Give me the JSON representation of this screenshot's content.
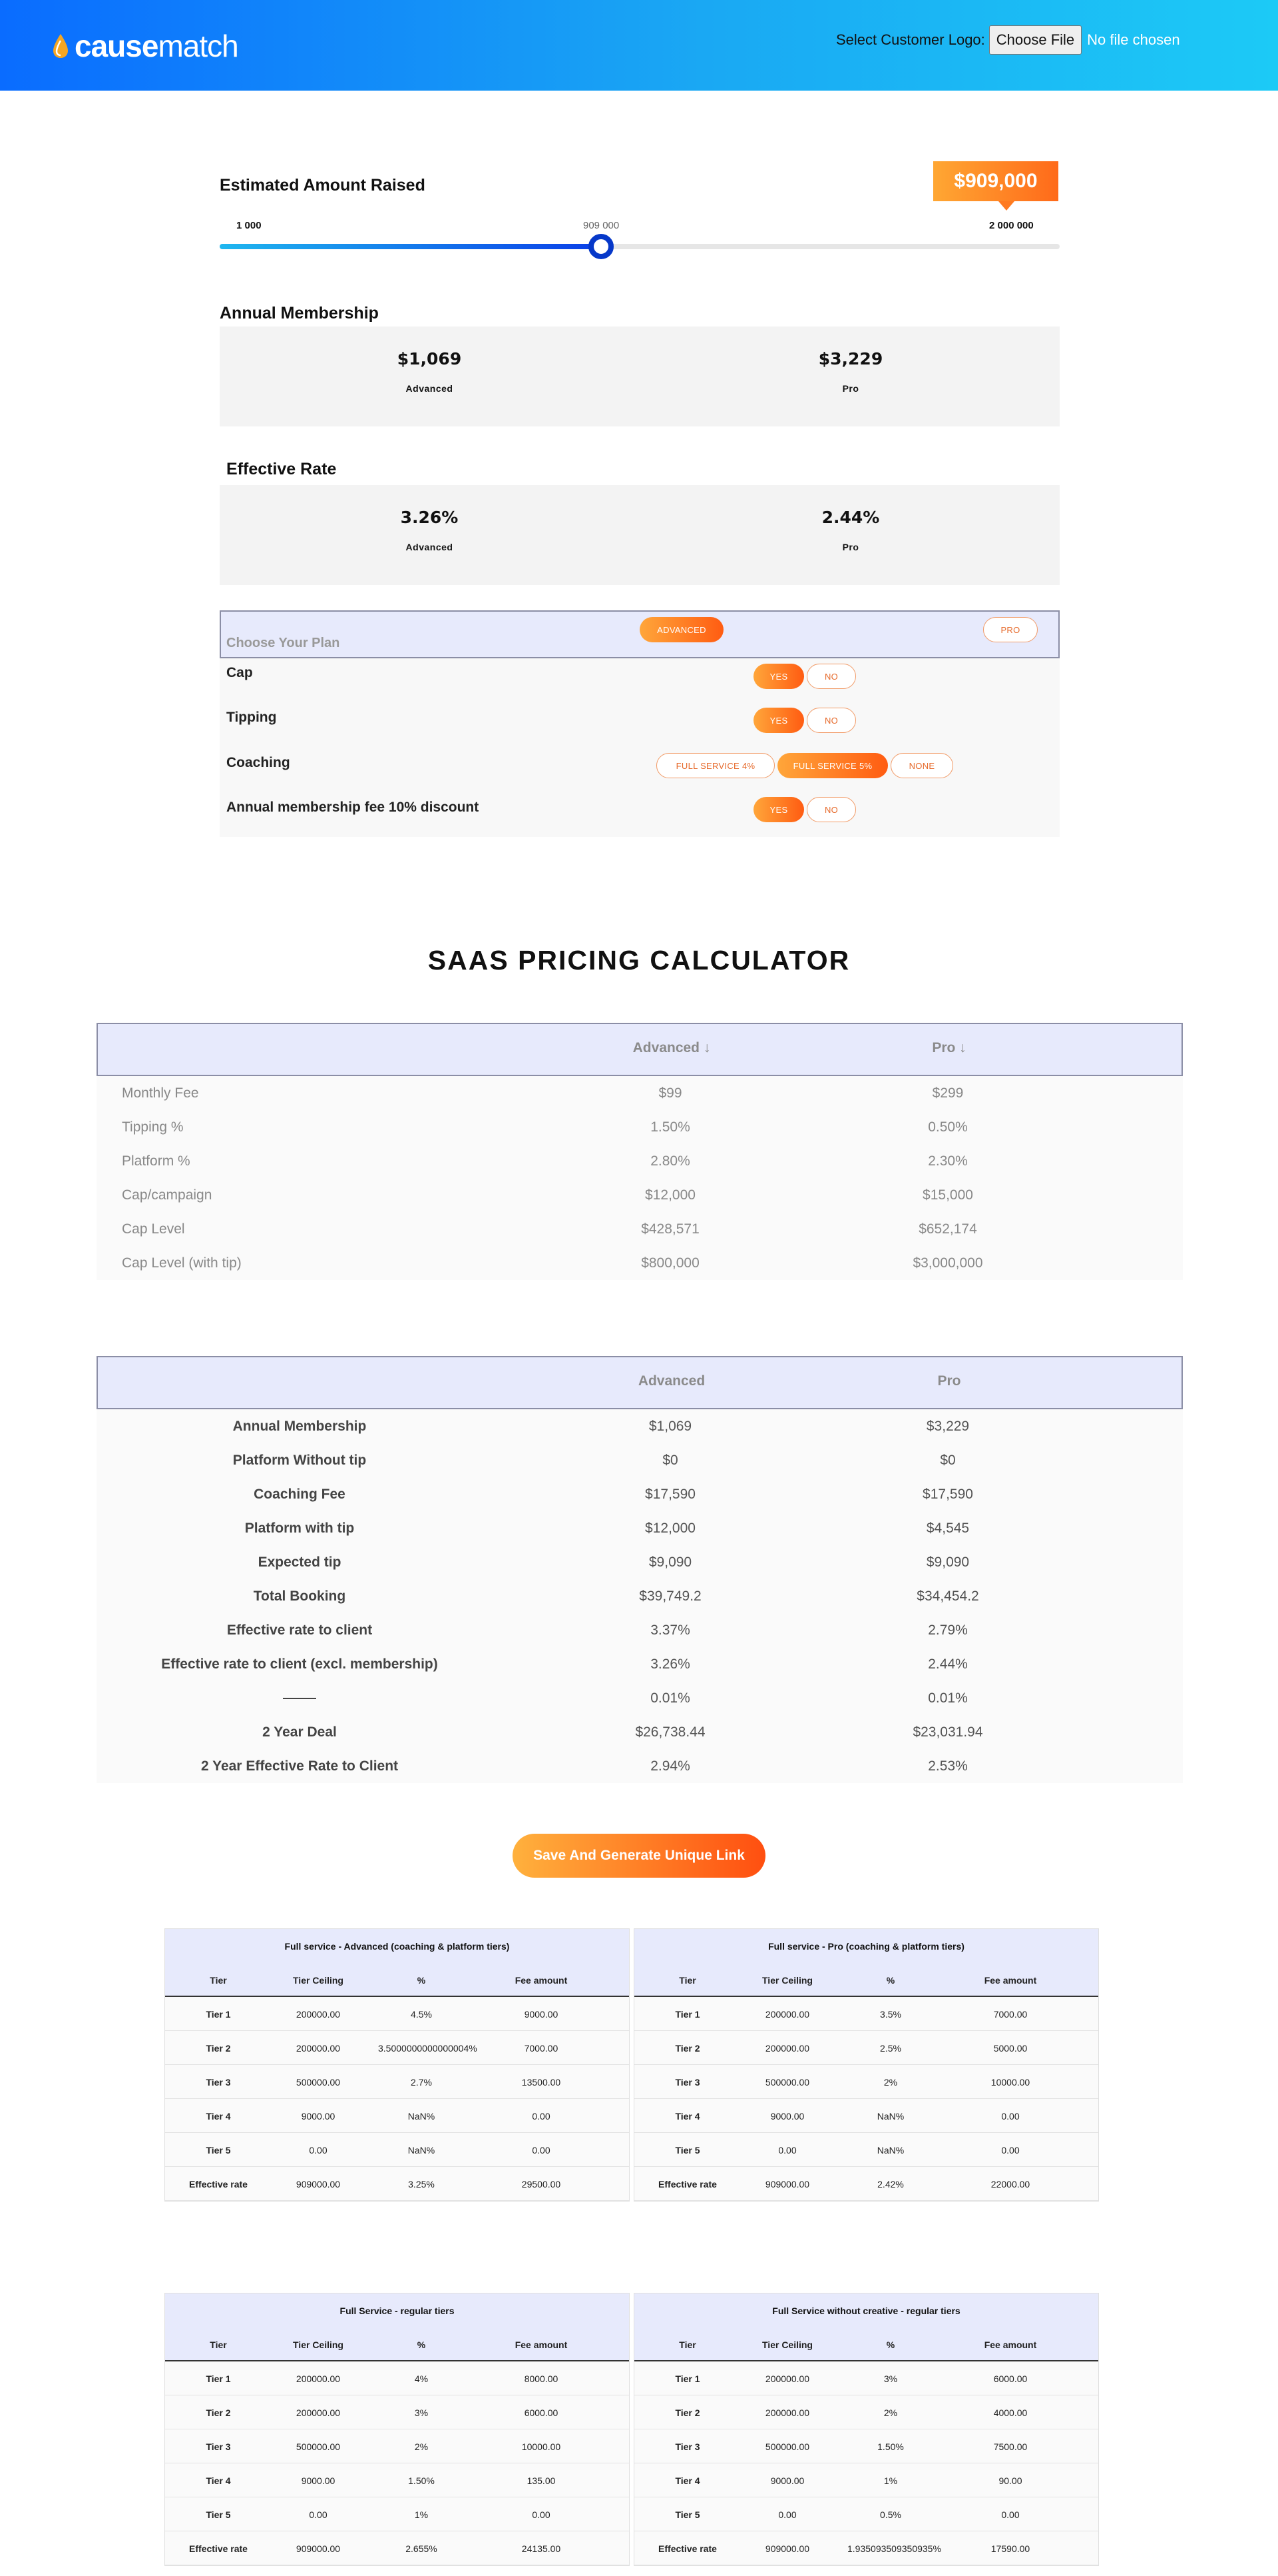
{
  "header": {
    "logo_bold": "cause",
    "logo_light": "match",
    "upload_label": "Select Customer Logo:",
    "choose_file": "Choose File",
    "no_file": "No file chosen"
  },
  "estimate": {
    "title": "Estimated Amount Raised",
    "badge": "$909,000",
    "min": "1 000",
    "max": "2 000 000",
    "current": "909 000",
    "fraction": 0.4541
  },
  "membership": {
    "title": "Annual Membership",
    "advanced_value": "$1,069",
    "advanced_label": "Advanced",
    "pro_value": "$3,229",
    "pro_label": "Pro"
  },
  "rate": {
    "title": "Effective Rate",
    "advanced_value": "3.26%",
    "advanced_label": "Advanced",
    "pro_value": "2.44%",
    "pro_label": "Pro"
  },
  "plan": {
    "label": "Choose Your Plan",
    "advanced": "ADVANCED",
    "pro": "PRO"
  },
  "options": {
    "cap": "Cap",
    "tipping": "Tipping",
    "coaching": "Coaching",
    "discount": "Annual membership fee 10% discount",
    "yes": "YES",
    "no": "NO",
    "fs4": "FULL SERVICE 4%",
    "fs5": "FULL SERVICE 5%",
    "none": "NONE"
  },
  "saas": {
    "title": "SAAS PRICING CALCULATOR",
    "col_advanced": "Advanced",
    "col_pro": "Pro",
    "rows": [
      {
        "k": "Monthly Fee",
        "a": "$99",
        "p": "$299"
      },
      {
        "k": "Tipping %",
        "a": "1.50%",
        "p": "0.50%"
      },
      {
        "k": "Platform %",
        "a": "2.80%",
        "p": "2.30%"
      },
      {
        "k": "Cap/campaign",
        "a": "$12,000",
        "p": "$15,000"
      },
      {
        "k": "Cap Level",
        "a": "$428,571",
        "p": "$652,174"
      },
      {
        "k": "Cap Level (with tip)",
        "a": "$800,000",
        "p": "$3,000,000"
      }
    ]
  },
  "summary": {
    "col_advanced": "Advanced",
    "col_pro": "Pro",
    "rows": [
      {
        "k": "Annual Membership",
        "a": "$1,069",
        "p": "$3,229"
      },
      {
        "k": "Platform Without tip",
        "a": "$0",
        "p": "$0"
      },
      {
        "k": "Coaching Fee",
        "a": "$17,590",
        "p": "$17,590"
      },
      {
        "k": "Platform with tip",
        "a": "$12,000",
        "p": "$4,545"
      },
      {
        "k": "Expected tip",
        "a": "$9,090",
        "p": "$9,090"
      },
      {
        "k": "Total Booking",
        "a": "$39,749.2",
        "p": "$34,454.2"
      },
      {
        "k": "Effective rate to client",
        "a": "3.37%",
        "p": "2.79%"
      },
      {
        "k": "Effective rate to client (excl. membership)",
        "a": "3.26%",
        "p": "2.44%"
      },
      {
        "k": "",
        "a": "0.01%",
        "p": "0.01%"
      },
      {
        "k": "2 Year Deal",
        "a": "$26,738.44",
        "p": "$23,031.94"
      },
      {
        "k": "2 Year Effective Rate to Client",
        "a": "2.94%",
        "p": "2.53%"
      }
    ]
  },
  "save_button": "Save And Generate Unique Link",
  "tiers": [
    {
      "title": "Full service - Advanced (coaching & platform tiers)",
      "cols": [
        "Tier",
        "Tier Ceiling",
        "%",
        "Fee amount"
      ],
      "rows": [
        [
          "Tier 1",
          "200000.00",
          "4.5%",
          "9000.00"
        ],
        [
          "Tier 2",
          "200000.00",
          "3.5000000000000004%",
          "7000.00"
        ],
        [
          "Tier 3",
          "500000.00",
          "2.7%",
          "13500.00"
        ],
        [
          "Tier 4",
          "9000.00",
          "NaN%",
          "0.00"
        ],
        [
          "Tier 5",
          "0.00",
          "NaN%",
          "0.00"
        ],
        [
          "Effective rate",
          "909000.00",
          "3.25%",
          "29500.00"
        ]
      ]
    },
    {
      "title": "Full service - Pro (coaching & platform tiers)",
      "cols": [
        "Tier",
        "Tier Ceiling",
        "%",
        "Fee amount"
      ],
      "rows": [
        [
          "Tier 1",
          "200000.00",
          "3.5%",
          "7000.00"
        ],
        [
          "Tier 2",
          "200000.00",
          "2.5%",
          "5000.00"
        ],
        [
          "Tier 3",
          "500000.00",
          "2%",
          "10000.00"
        ],
        [
          "Tier 4",
          "9000.00",
          "NaN%",
          "0.00"
        ],
        [
          "Tier 5",
          "0.00",
          "NaN%",
          "0.00"
        ],
        [
          "Effective rate",
          "909000.00",
          "2.42%",
          "22000.00"
        ]
      ]
    },
    {
      "title": "Full Service - regular tiers",
      "cols": [
        "Tier",
        "Tier Ceiling",
        "%",
        "Fee amount"
      ],
      "rows": [
        [
          "Tier 1",
          "200000.00",
          "4%",
          "8000.00"
        ],
        [
          "Tier 2",
          "200000.00",
          "3%",
          "6000.00"
        ],
        [
          "Tier 3",
          "500000.00",
          "2%",
          "10000.00"
        ],
        [
          "Tier 4",
          "9000.00",
          "1.50%",
          "135.00"
        ],
        [
          "Tier 5",
          "0.00",
          "1%",
          "0.00"
        ],
        [
          "Effective rate",
          "909000.00",
          "2.655%",
          "24135.00"
        ]
      ]
    },
    {
      "title": "Full Service without creative - regular tiers",
      "cols": [
        "Tier",
        "Tier Ceiling",
        "%",
        "Fee amount"
      ],
      "rows": [
        [
          "Tier 1",
          "200000.00",
          "3%",
          "6000.00"
        ],
        [
          "Tier 2",
          "200000.00",
          "2%",
          "4000.00"
        ],
        [
          "Tier 3",
          "500000.00",
          "1.50%",
          "7500.00"
        ],
        [
          "Tier 4",
          "9000.00",
          "1%",
          "90.00"
        ],
        [
          "Tier 5",
          "0.00",
          "0.5%",
          "0.00"
        ],
        [
          "Effective rate",
          "909000.00",
          "1.935093509350935%",
          "17590.00"
        ]
      ]
    }
  ]
}
